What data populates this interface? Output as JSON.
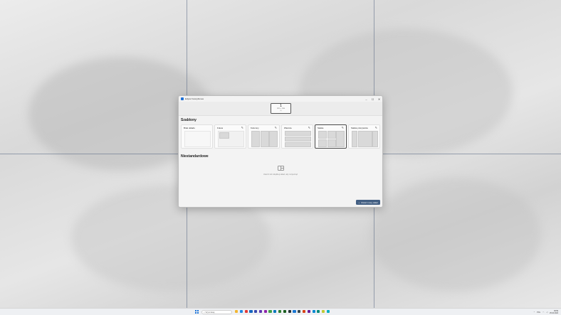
{
  "window": {
    "title": "Edytor FancyZones",
    "controls": [
      "–",
      "☐",
      "✕"
    ]
  },
  "monitor": {
    "number": "1",
    "resolution": "1920 × 1200",
    "sub": "(1)"
  },
  "sections": {
    "templates_title": "Szablony",
    "custom_title": "Niestandardowe"
  },
  "templates": [
    {
      "label": "Brak układu"
    },
    {
      "label": "Fokus"
    },
    {
      "label": "Kolumny"
    },
    {
      "label": "Wiersze"
    },
    {
      "label": "Siatka"
    },
    {
      "label": "Siatka priorytetów"
    }
  ],
  "empty_state": {
    "text": "Utwórz lub zduplikuj układ, aby rozpocząć"
  },
  "create_button": {
    "label": "Utwórz nowy układ",
    "icon": "+"
  },
  "taskbar": {
    "search_placeholder": "Wyszukaj",
    "tray_lang": "POL",
    "time": "09:59",
    "date": "25.04.2024"
  },
  "colors": {
    "accent": "#435f83",
    "grid_lines": "#5a6a85",
    "windows_blue": "#1a73d9"
  }
}
